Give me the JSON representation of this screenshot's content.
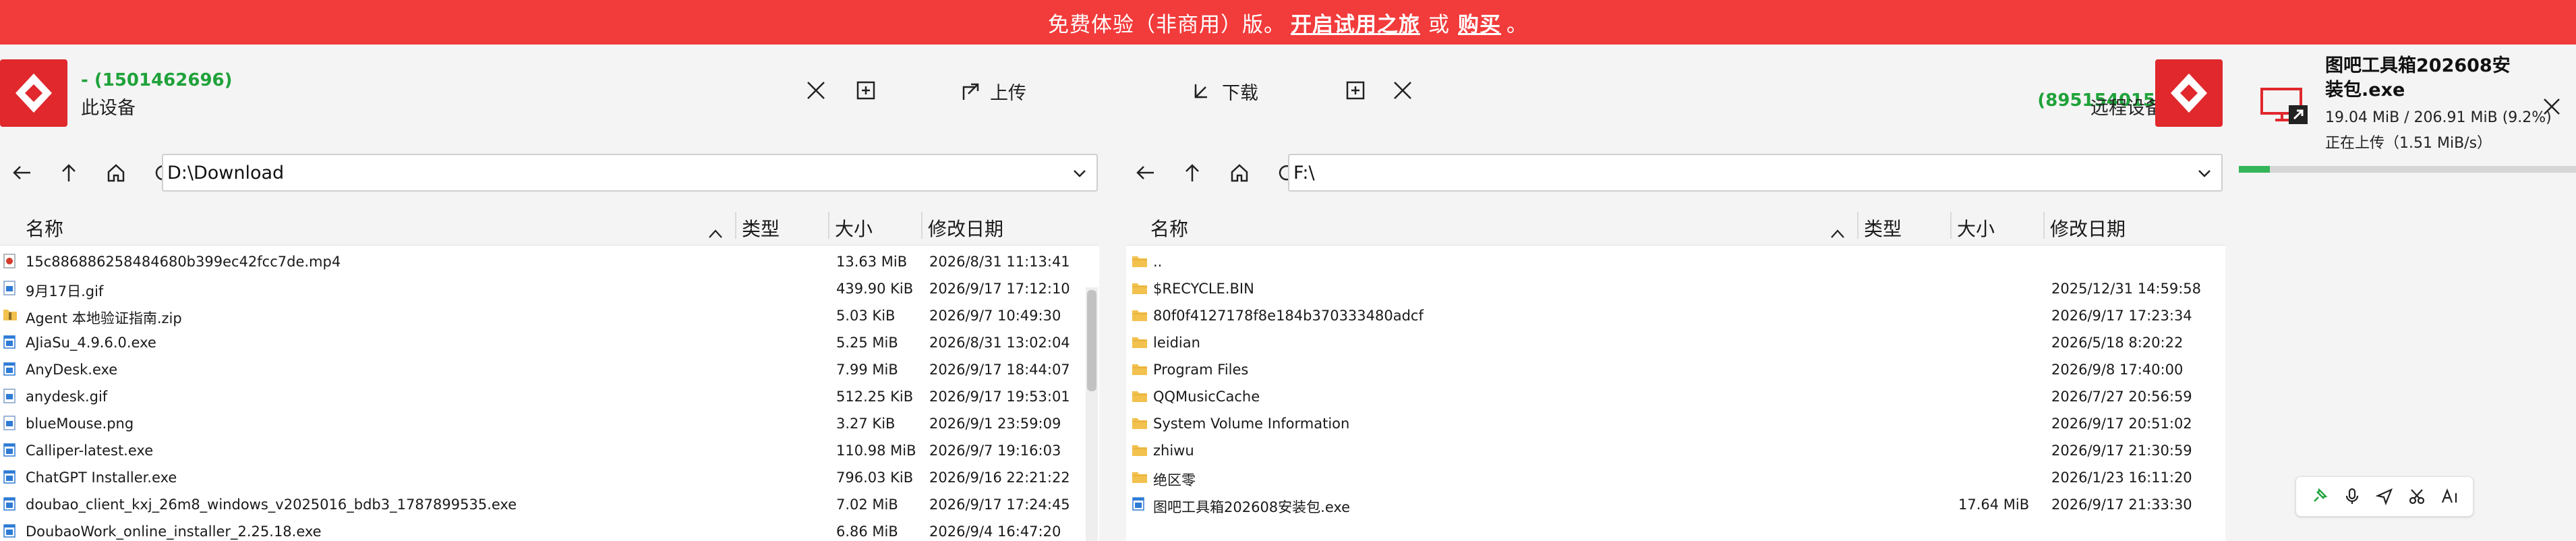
{
  "banner": {
    "text_prefix": "免费体验（非商用）版。",
    "trial_link": "开启试用之旅",
    "connector": "或",
    "buy_link": "购买",
    "suffix": "。"
  },
  "left_pane": {
    "device_id": "- (1501462696)",
    "device_name": "此设备",
    "upload_label": "上传",
    "path": "D:\\Download",
    "columns": {
      "name": "名称",
      "type": "类型",
      "size": "大小",
      "modified": "修改日期"
    },
    "files": [
      {
        "name": "15c886886258484680b399ec42fcc7de.mp4",
        "size": "13.63 MiB",
        "modified": "2026/8/31 11:13:41",
        "icon": "video-file-icon"
      },
      {
        "name": "9月17日.gif",
        "size": "439.90 KiB",
        "modified": "2026/9/17 17:12:10",
        "icon": "image-file-icon"
      },
      {
        "name": "Agent 本地验证指南.zip",
        "size": "5.03 KiB",
        "modified": "2026/9/7 10:49:30",
        "icon": "zip-file-icon"
      },
      {
        "name": "AJiaSu_4.9.6.0.exe",
        "size": "5.25 MiB",
        "modified": "2026/8/31 13:02:04",
        "icon": "exe-file-icon"
      },
      {
        "name": "AnyDesk.exe",
        "size": "7.99 MiB",
        "modified": "2026/9/17 18:44:07",
        "icon": "exe-file-icon"
      },
      {
        "name": "anydesk.gif",
        "size": "512.25 KiB",
        "modified": "2026/9/17 19:53:01",
        "icon": "image-file-icon"
      },
      {
        "name": "blueMouse.png",
        "size": "3.27 KiB",
        "modified": "2026/9/1 23:59:09",
        "icon": "image-file-icon"
      },
      {
        "name": "Calliper-latest.exe",
        "size": "110.98 MiB",
        "modified": "2026/9/7 19:16:03",
        "icon": "exe-file-icon"
      },
      {
        "name": "ChatGPT Installer.exe",
        "size": "796.03 KiB",
        "modified": "2026/9/16 22:21:22",
        "icon": "exe-file-icon"
      },
      {
        "name": "doubao_client_kxj_26m8_windows_v2025016_bdb3_1787899535.exe",
        "size": "7.02 MiB",
        "modified": "2026/9/17 17:24:45",
        "icon": "exe-file-icon"
      },
      {
        "name": "DoubaoWork_online_installer_2.25.18.exe",
        "size": "6.86 MiB",
        "modified": "2026/9/4 16:47:20",
        "icon": "exe-file-icon"
      }
    ]
  },
  "right_pane": {
    "device_id": "- (895154015)",
    "device_name": "远程设备",
    "download_label": "下载",
    "path": "F:\\",
    "columns": {
      "name": "名称",
      "type": "类型",
      "size": "大小",
      "modified": "修改日期"
    },
    "files": [
      {
        "name": "..",
        "size": "",
        "modified": "",
        "icon": "folder-icon"
      },
      {
        "name": "$RECYCLE.BIN",
        "size": "",
        "modified": "2025/12/31 14:59:58",
        "icon": "folder-icon"
      },
      {
        "name": "80f0f4127178f8e184b370333480adcf",
        "size": "",
        "modified": "2026/9/17 17:23:34",
        "icon": "folder-icon"
      },
      {
        "name": "leidian",
        "size": "",
        "modified": "2026/5/18 8:20:22",
        "icon": "folder-icon"
      },
      {
        "name": "Program Files",
        "size": "",
        "modified": "2026/9/8 17:40:00",
        "icon": "folder-icon"
      },
      {
        "name": "QQMusicCache",
        "size": "",
        "modified": "2026/7/27 20:56:59",
        "icon": "folder-icon"
      },
      {
        "name": "System Volume Information",
        "size": "",
        "modified": "2026/9/17 20:51:02",
        "icon": "folder-icon"
      },
      {
        "name": "zhiwu",
        "size": "",
        "modified": "2026/9/17 21:30:59",
        "icon": "folder-icon"
      },
      {
        "name": "绝区零",
        "size": "",
        "modified": "2026/1/23 16:11:20",
        "icon": "folder-icon"
      },
      {
        "name": "图吧工具箱202608安装包.exe",
        "size": "17.64 MiB",
        "modified": "2026/9/17 21:33:30",
        "icon": "exe-file-icon"
      }
    ]
  },
  "transfer": {
    "title": "图吧工具箱202608安装包.exe",
    "progress_text": "19.04 MiB / 206.91 MiB (9.2%)",
    "status_text": "正在上传（1.51 MiB/s）",
    "progress_fraction": 0.092
  },
  "colors": {
    "banner": "#f23b3b",
    "brand_red": "#e0282d",
    "id_green": "#1fa23a",
    "progress": "#35b559"
  }
}
